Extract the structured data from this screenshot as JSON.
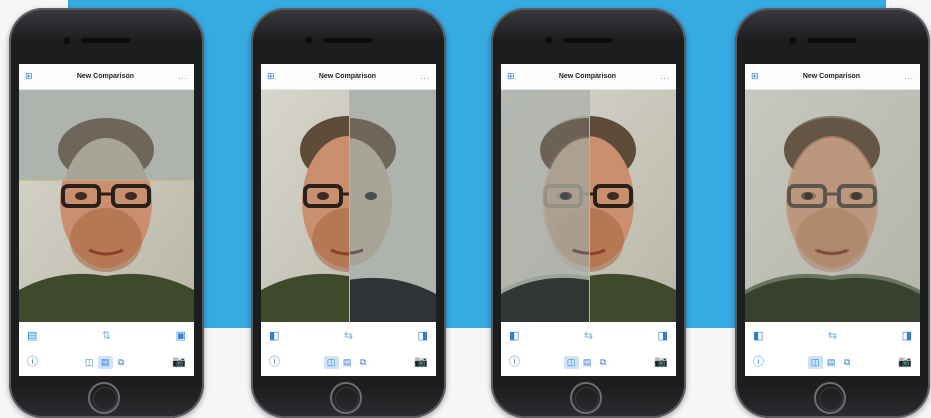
{
  "colors": {
    "background_band": "#35abe2",
    "accent": "#2f7fd8",
    "divider": "#d9b25a"
  },
  "phones": [
    {
      "title": "New Comparison",
      "menu_icon": "grid-icon",
      "more_label": "...",
      "mode": "horizontal-split",
      "top_left_icon": "split-top-icon",
      "center_icon": "swap-vertical-icon",
      "top_right_icon": "split-bottom-icon",
      "info_icon": "info-icon",
      "camera_icon": "camera-icon",
      "selected_segment": 1
    },
    {
      "title": "New Comparison",
      "menu_icon": "grid-icon",
      "more_label": "...",
      "mode": "vertical-split",
      "top_left_icon": "split-left-icon",
      "center_icon": "swap-horizontal-icon",
      "top_right_icon": "split-right-icon",
      "info_icon": "info-icon",
      "camera_icon": "camera-icon",
      "selected_segment": 0
    },
    {
      "title": "New Comparison",
      "menu_icon": "grid-icon",
      "more_label": "...",
      "mode": "vertical-split-faded",
      "top_left_icon": "split-left-icon",
      "center_icon": "swap-horizontal-icon",
      "top_right_icon": "split-right-icon",
      "info_icon": "info-icon",
      "camera_icon": "camera-icon",
      "selected_segment": 0
    },
    {
      "title": "New Comparison",
      "menu_icon": "grid-icon",
      "more_label": "...",
      "mode": "overlay",
      "top_left_icon": "split-left-icon",
      "center_icon": "swap-horizontal-icon",
      "top_right_icon": "split-right-icon",
      "info_icon": "info-icon",
      "camera_icon": "camera-icon",
      "selected_segment": 0
    }
  ]
}
